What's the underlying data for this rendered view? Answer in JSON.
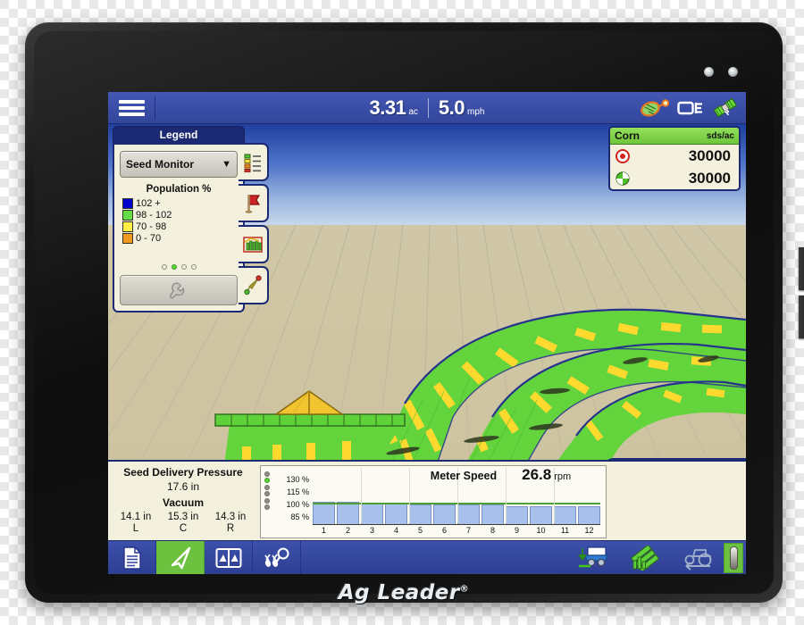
{
  "device": {
    "brand": "Ag Leader",
    "brand_mark": "®",
    "led_left": "power-led",
    "led_right": "status-led"
  },
  "topbar": {
    "menu_icon": "hamburger-menu-icon",
    "area": {
      "value": "3.31",
      "unit": "ac"
    },
    "speed": {
      "value": "5.0",
      "unit": "mph"
    },
    "icons": [
      {
        "name": "seed-vacuum-icon"
      },
      {
        "name": "display-implement-icon"
      },
      {
        "name": "gps-satellite-icon"
      }
    ]
  },
  "legend": {
    "tab_label": "Legend",
    "selected_source": "Seed Monitor",
    "caret": "▼",
    "title": "Population %",
    "items": [
      {
        "color": "#0000cc",
        "label": "102 +"
      },
      {
        "color": "#66dd44",
        "label": "98 - 102"
      },
      {
        "color": "#ffee44",
        "label": "70 - 98"
      },
      {
        "color": "#ee9922",
        "label": "0 - 70"
      }
    ],
    "page_dots": 4,
    "active_dot": 1,
    "settings_icon": "wrench-icon"
  },
  "side_tabs": [
    {
      "name": "legend-list-tab",
      "icon": "legend-list-icon"
    },
    {
      "name": "flag-tab",
      "icon": "red-flag-icon"
    },
    {
      "name": "chart-tab",
      "icon": "bar-chart-icon"
    },
    {
      "name": "marker-tab",
      "icon": "compass-marker-icon"
    }
  ],
  "product_panel": {
    "crop": "Corn",
    "unit": "sds/ac",
    "rows": [
      {
        "icon": "target-rate-icon",
        "value": "30000"
      },
      {
        "icon": "actual-rate-icon",
        "value": "30000"
      }
    ]
  },
  "settings_tab": {
    "label": "Settings",
    "icon": "wrench-icon"
  },
  "seed_delivery": {
    "title": "Seed Delivery Pressure",
    "pressure": "17.6 in",
    "vacuum_title": "Vacuum",
    "vacuum": [
      {
        "value": "14.1 in",
        "label": "L"
      },
      {
        "value": "15.3 in",
        "label": "C"
      },
      {
        "value": "14.3 in",
        "label": "R"
      }
    ]
  },
  "chart_data": {
    "type": "bar",
    "title": "Meter Speed",
    "value": "26.8",
    "unit": "rpm",
    "categories": [
      "1",
      "2",
      "3",
      "4",
      "5",
      "6",
      "7",
      "8",
      "9",
      "10",
      "11",
      "12"
    ],
    "values": [
      103,
      103,
      102,
      102,
      100,
      100,
      100,
      100,
      98,
      98,
      98,
      98
    ],
    "ytick_labels": [
      "130 %",
      "115 %",
      "100 %",
      "85 %"
    ],
    "ylim": [
      75,
      140
    ],
    "target_line": 100,
    "xlabel": "",
    "ylabel": "",
    "grid": true,
    "legend": "none",
    "indicator_dots": 6,
    "indicator_active": 1
  },
  "toolbar": {
    "left": [
      {
        "name": "reports-button",
        "icon": "document-icon",
        "active": false
      },
      {
        "name": "map-view-button",
        "icon": "navigation-arrow-icon",
        "active": true
      },
      {
        "name": "split-screen-button",
        "icon": "split-screen-icon",
        "active": false
      },
      {
        "name": "seed-diagnostics-button",
        "icon": "seed-magnifier-icon",
        "active": false
      }
    ],
    "right": [
      {
        "name": "planter-lower-button",
        "icon": "planter-down-icon"
      },
      {
        "name": "coverage-layers-button",
        "icon": "green-layers-icon"
      },
      {
        "name": "tractor-reverse-button",
        "icon": "tractor-reverse-icon"
      }
    ],
    "battery_icon": "battery-level-icon"
  },
  "colors": {
    "accent_blue": "#2d3f92",
    "accent_green": "#6cc23f",
    "panel_cream": "#f3f0dd",
    "panel_border": "#1b2a73"
  }
}
